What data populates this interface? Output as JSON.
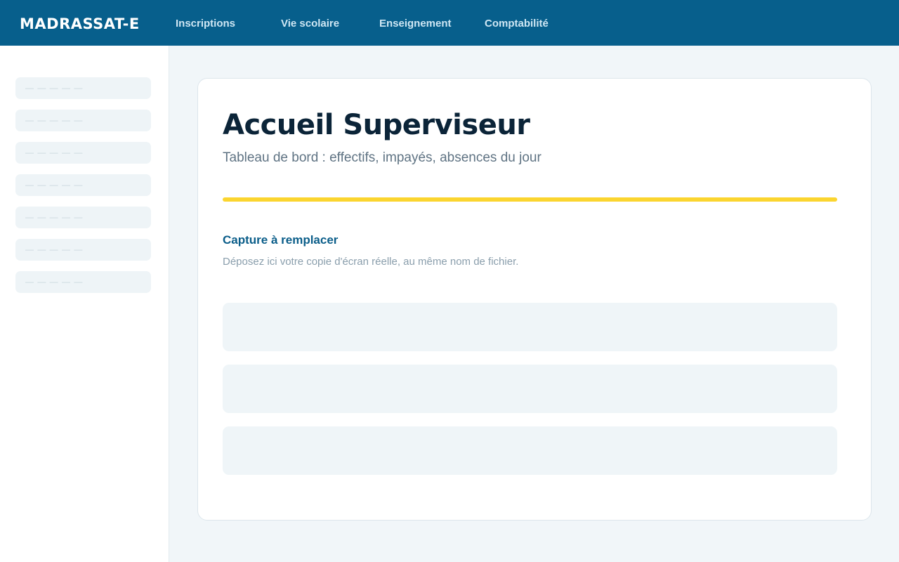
{
  "app": {
    "brand": "MADRASSAT-E"
  },
  "nav": {
    "items": [
      {
        "label": "Inscriptions"
      },
      {
        "label": "Vie scolaire"
      },
      {
        "label": "Enseignement"
      },
      {
        "label": "Comptabilité"
      }
    ]
  },
  "sidebar": {
    "items": [
      {
        "label": "— — — — —"
      },
      {
        "label": "— — — — —"
      },
      {
        "label": "— — — — —"
      },
      {
        "label": "— — — — —"
      },
      {
        "label": "— — — — —"
      },
      {
        "label": "— — — — —"
      },
      {
        "label": "— — — — —"
      }
    ]
  },
  "main": {
    "title": "Accueil Superviseur",
    "subtitle": "Tableau de bord : effectifs, impayés, absences du jour",
    "capture": {
      "title": "Capture à remplacer",
      "description": "Déposez ici votre copie d'écran réelle, au même nom de fichier."
    }
  },
  "colors": {
    "header_bg": "#075f8c",
    "accent": "#fbd52f",
    "title": "#0b2438",
    "link": "#0a5d89"
  }
}
